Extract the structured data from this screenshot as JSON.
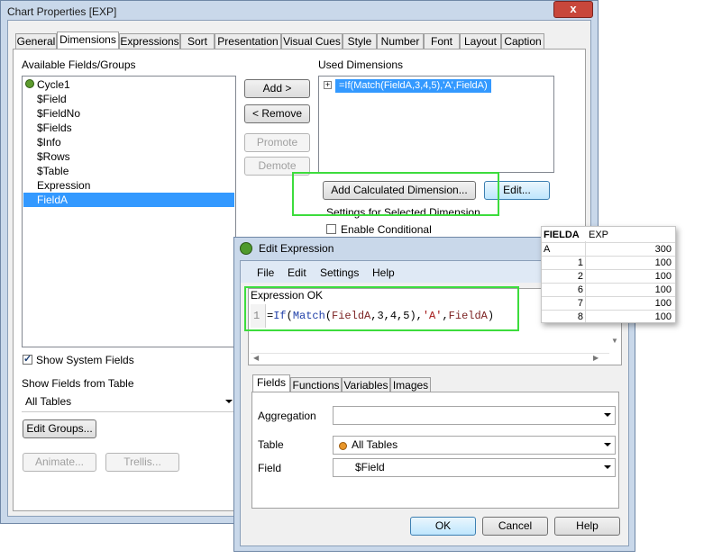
{
  "main_dialog": {
    "title": "Chart Properties [EXP]",
    "close_glyph": "x",
    "tabs": [
      "General",
      "Dimensions",
      "Expressions",
      "Sort",
      "Presentation",
      "Visual Cues",
      "Style",
      "Number",
      "Font",
      "Layout",
      "Caption"
    ],
    "active_tab": "Dimensions",
    "available_label": "Available Fields/Groups",
    "available_items": [
      "Cycle1",
      "$Field",
      "$FieldNo",
      "$Fields",
      "$Info",
      "$Rows",
      "$Table",
      "Expression",
      "FieldA"
    ],
    "selected_available": "FieldA",
    "used_label": "Used Dimensions",
    "used_items": [
      "=If(Match(FieldA,3,4,5),'A',FieldA)"
    ],
    "buttons": {
      "add": "Add >",
      "remove": "< Remove",
      "promote": "Promote",
      "demote": "Demote",
      "add_calculated": "Add Calculated Dimension...",
      "edit": "Edit...",
      "edit_groups": "Edit Groups...",
      "animate": "Animate...",
      "trellis": "Trellis..."
    },
    "settings_label": "Settings for Selected Dimension",
    "enable_conditional": "Enable Conditional",
    "show_system_fields": "Show System Fields",
    "show_system_checked": true,
    "show_fields_from_table_label": "Show Fields from Table",
    "show_fields_value": "All Tables"
  },
  "edit_expression": {
    "title": "Edit Expression",
    "menu": [
      "File",
      "Edit",
      "Settings",
      "Help"
    ],
    "status": "Expression OK",
    "line_number": "1",
    "code": {
      "eq": "=",
      "fn_if": "If",
      "p1": "(",
      "fn_match": "Match",
      "p2": "(",
      "field1": "FieldA",
      "nums": ",3,4,5),",
      "str_a": "'A'",
      "comma": ",",
      "field2": "FieldA",
      "p3": ")"
    },
    "tabs": [
      "Fields",
      "Functions",
      "Variables",
      "Images"
    ],
    "active_tab": "Fields",
    "aggregation_label": "Aggregation",
    "aggregation_value": "",
    "table_label": "Table",
    "table_value": "All Tables",
    "field_label": "Field",
    "field_value": "$Field",
    "buttons": {
      "ok": "OK",
      "cancel": "Cancel",
      "help": "Help"
    }
  },
  "result_table": {
    "headers": [
      "FIELDA",
      "EXP"
    ],
    "rows": [
      [
        "A",
        "300"
      ],
      [
        "1",
        "100"
      ],
      [
        "2",
        "100"
      ],
      [
        "6",
        "100"
      ],
      [
        "7",
        "100"
      ],
      [
        "8",
        "100"
      ]
    ]
  },
  "colors": {
    "highlight": "#3399ff",
    "annotation_box": "#3ddc3d",
    "frame": "#c9d8ea",
    "function_blue": "#1f3fa8",
    "string_red": "#a31515"
  }
}
